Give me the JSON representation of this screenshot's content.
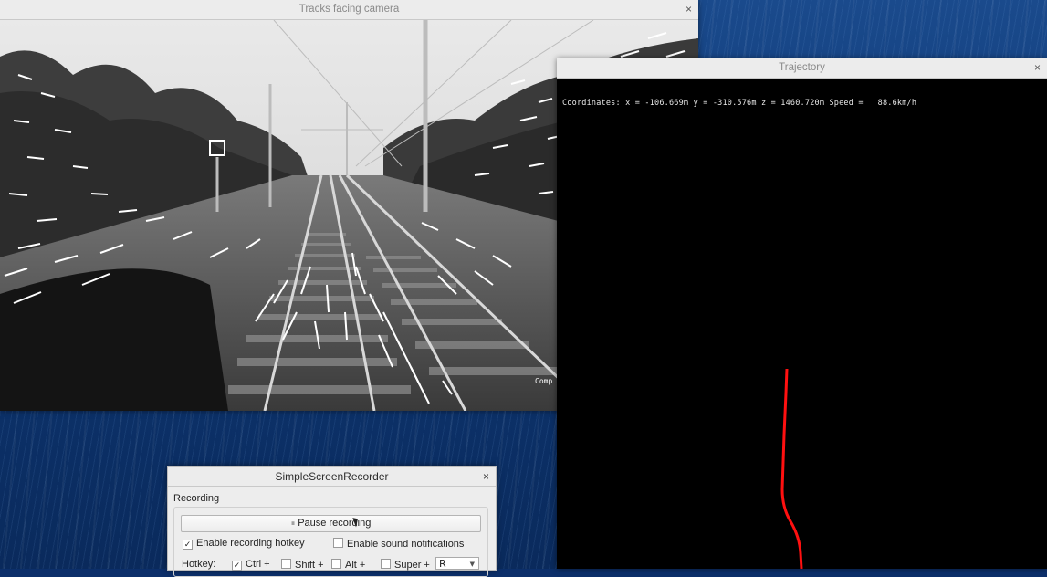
{
  "camera_window": {
    "title": "Tracks facing camera",
    "close_label": "×",
    "overlay_text": "Comp"
  },
  "trajectory_window": {
    "title": "Trajectory",
    "close_label": "×",
    "coordinates_text": "Coordinates: x = -106.669m y = -310.576m z = 1460.720m Speed =   88.6km/h",
    "trace_color": "#ff1010"
  },
  "recorder_window": {
    "title": "SimpleScreenRecorder",
    "close_label": "×",
    "group_label": "Recording",
    "pause_label": "Pause recording",
    "enable_hotkey_label": "Enable recording hotkey",
    "enable_hotkey_checked": true,
    "sound_notifications_label": "Enable sound notifications",
    "sound_notifications_checked": false,
    "hotkey_label": "Hotkey:",
    "ctrl_label": "Ctrl +",
    "ctrl_checked": true,
    "shift_label": "Shift +",
    "alt_label": "Alt +",
    "super_label": "Super +",
    "key_value": "R"
  }
}
